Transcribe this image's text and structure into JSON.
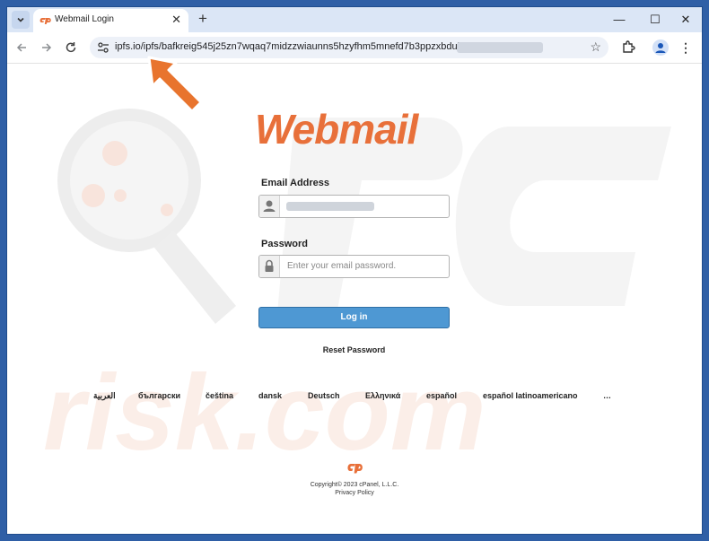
{
  "browser": {
    "tab_title": "Webmail Login",
    "new_tab_label": "+",
    "url": "ipfs.io/ipfs/bafkreig545j25zn7wqaq7midzzwiaunns5hzyfhm5mnefd7b3ppzxbduke#",
    "window_controls": {
      "minimize": "—",
      "maximize": "☐",
      "close": "✕"
    }
  },
  "login": {
    "logo_text": "Webmail",
    "email_label": "Email Address",
    "password_label": "Password",
    "password_placeholder": "Enter your email password.",
    "login_button": "Log in",
    "reset_password": "Reset Password"
  },
  "languages": [
    "العربية",
    "български",
    "čeština",
    "dansk",
    "Deutsch",
    "Ελληνικά",
    "español",
    "español latinoamericano",
    "…"
  ],
  "footer": {
    "copyright": "Copyright© 2023 cPanel, L.L.C.",
    "privacy": "Privacy Policy"
  },
  "colors": {
    "logo": "#e8703a",
    "button": "#4e98d3",
    "arrow": "#e8742e",
    "window_frame": "#2f5fa6"
  },
  "icons": {
    "user": "user-icon",
    "lock": "lock-icon",
    "star": "star-icon",
    "close": "close-icon"
  }
}
